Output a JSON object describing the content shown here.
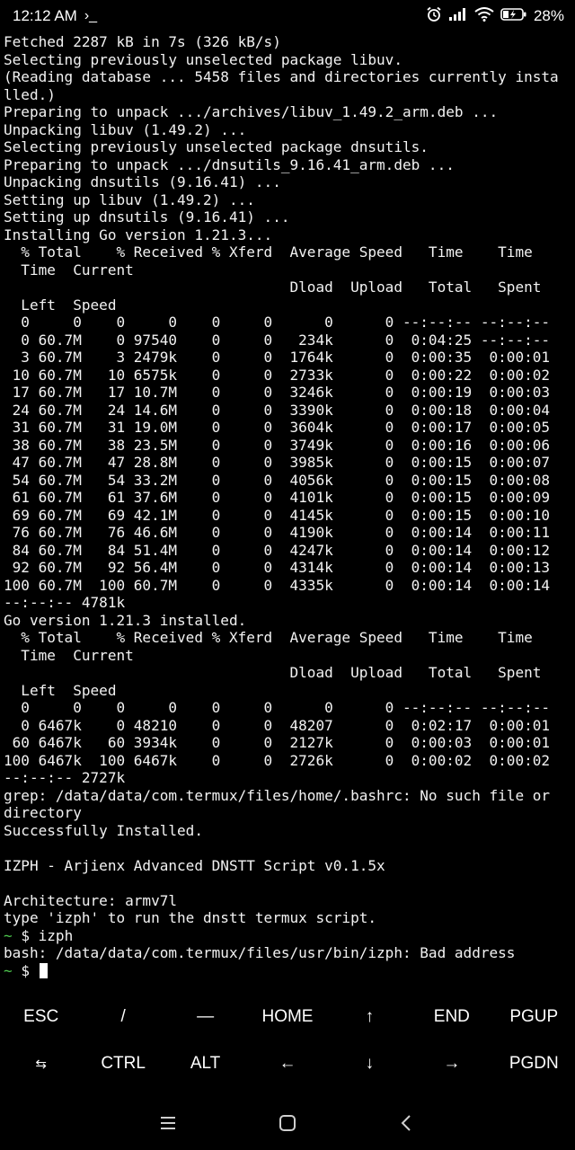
{
  "status_bar": {
    "time": "12:12 AM",
    "prompt_glyph": "›_",
    "battery": "28%"
  },
  "terminal": {
    "lines": [
      "Fetched 2287 kB in 7s (326 kB/s)",
      "Selecting previously unselected package libuv.",
      "(Reading database ... 5458 files and directories currently insta",
      "lled.)",
      "Preparing to unpack .../archives/libuv_1.49.2_arm.deb ...",
      "Unpacking libuv (1.49.2) ...",
      "Selecting previously unselected package dnsutils.",
      "Preparing to unpack .../dnsutils_9.16.41_arm.deb ...",
      "Unpacking dnsutils (9.16.41) ...",
      "Setting up libuv (1.49.2) ...",
      "Setting up dnsutils (9.16.41) ...",
      "Installing Go version 1.21.3...",
      "  % Total    % Received % Xferd  Average Speed   Time    Time",
      "  Time  Current",
      "                                 Dload  Upload   Total   Spent",
      "  Left  Speed",
      "  0     0    0     0    0     0      0      0 --:--:-- --:--:--",
      "  0 60.7M    0 97540    0     0   234k      0  0:04:25 --:--:--",
      "  3 60.7M    3 2479k    0     0  1764k      0  0:00:35  0:00:01",
      " 10 60.7M   10 6575k    0     0  2733k      0  0:00:22  0:00:02",
      " 17 60.7M   17 10.7M    0     0  3246k      0  0:00:19  0:00:03",
      " 24 60.7M   24 14.6M    0     0  3390k      0  0:00:18  0:00:04",
      " 31 60.7M   31 19.0M    0     0  3604k      0  0:00:17  0:00:05",
      " 38 60.7M   38 23.5M    0     0  3749k      0  0:00:16  0:00:06",
      " 47 60.7M   47 28.8M    0     0  3985k      0  0:00:15  0:00:07",
      " 54 60.7M   54 33.2M    0     0  4056k      0  0:00:15  0:00:08",
      " 61 60.7M   61 37.6M    0     0  4101k      0  0:00:15  0:00:09",
      " 69 60.7M   69 42.1M    0     0  4145k      0  0:00:15  0:00:10",
      " 76 60.7M   76 46.6M    0     0  4190k      0  0:00:14  0:00:11",
      " 84 60.7M   84 51.4M    0     0  4247k      0  0:00:14  0:00:12",
      " 92 60.7M   92 56.4M    0     0  4314k      0  0:00:14  0:00:13",
      "100 60.7M  100 60.7M    0     0  4335k      0  0:00:14  0:00:14",
      "--:--:-- 4781k",
      "Go version 1.21.3 installed.",
      "  % Total    % Received % Xferd  Average Speed   Time    Time",
      "  Time  Current",
      "                                 Dload  Upload   Total   Spent",
      "  Left  Speed",
      "  0     0    0     0    0     0      0      0 --:--:-- --:--:--",
      "  0 6467k    0 48210    0     0  48207      0  0:02:17  0:00:01",
      " 60 6467k   60 3934k    0     0  2127k      0  0:00:03  0:00:01",
      "100 6467k  100 6467k    0     0  2726k      0  0:00:02  0:00:02",
      "--:--:-- 2727k",
      "grep: /data/data/com.termux/files/home/.bashrc: No such file or",
      "directory",
      "Successfully Installed.",
      "",
      "IZPH - Arjienx Advanced DNSTT Script v0.1.5x",
      "",
      "Architecture: armv7l",
      "type 'izph' to run the dnstt termux script."
    ],
    "prompt_tilde": "~",
    "prompt_symbol": "$",
    "command_1": "izph",
    "error_line": "bash: /data/data/com.termux/files/usr/bin/izph: Bad address"
  },
  "extra_keys": {
    "row1": [
      "ESC",
      "/",
      "—",
      "HOME",
      "↑",
      "END",
      "PGUP"
    ],
    "row2": [
      "⇆",
      "CTRL",
      "ALT",
      "←",
      "↓",
      "→",
      "PGDN"
    ]
  },
  "colors": {
    "background": "#000000",
    "text": "#f2f2f2",
    "prompt_tilde": "#4ec94e"
  }
}
